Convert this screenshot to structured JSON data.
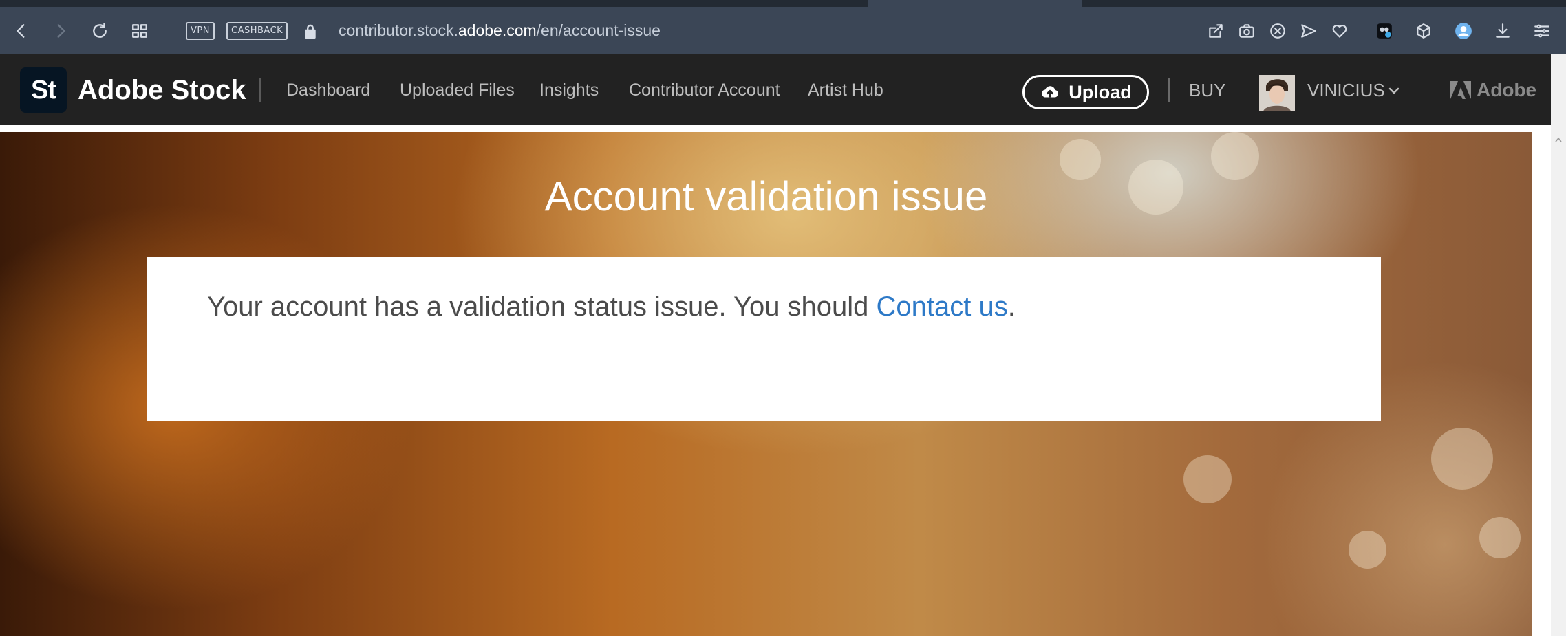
{
  "browser": {
    "pills": {
      "vpn": "VPN",
      "cashback": "CASHBACK"
    },
    "url": {
      "prefix": "contributor.stock.",
      "host": "adobe.com",
      "path": "/en/account-issue"
    }
  },
  "header": {
    "logo_text": "St",
    "brand": "Adobe Stock",
    "nav": [
      "Dashboard",
      "Uploaded Files",
      "Insights",
      "Contributor Account",
      "Artist Hub"
    ],
    "upload_label": "Upload",
    "buy_label": "BUY",
    "username": "VINICIUS",
    "adobe_label": "Adobe"
  },
  "main": {
    "title": "Account validation issue",
    "message": "Your account has a validation status issue. You should ",
    "link": "Contact us",
    "message_end": "."
  },
  "colors": {
    "chrome_bg": "#3b4656",
    "header_bg": "#222222",
    "link": "#2d79c7"
  }
}
